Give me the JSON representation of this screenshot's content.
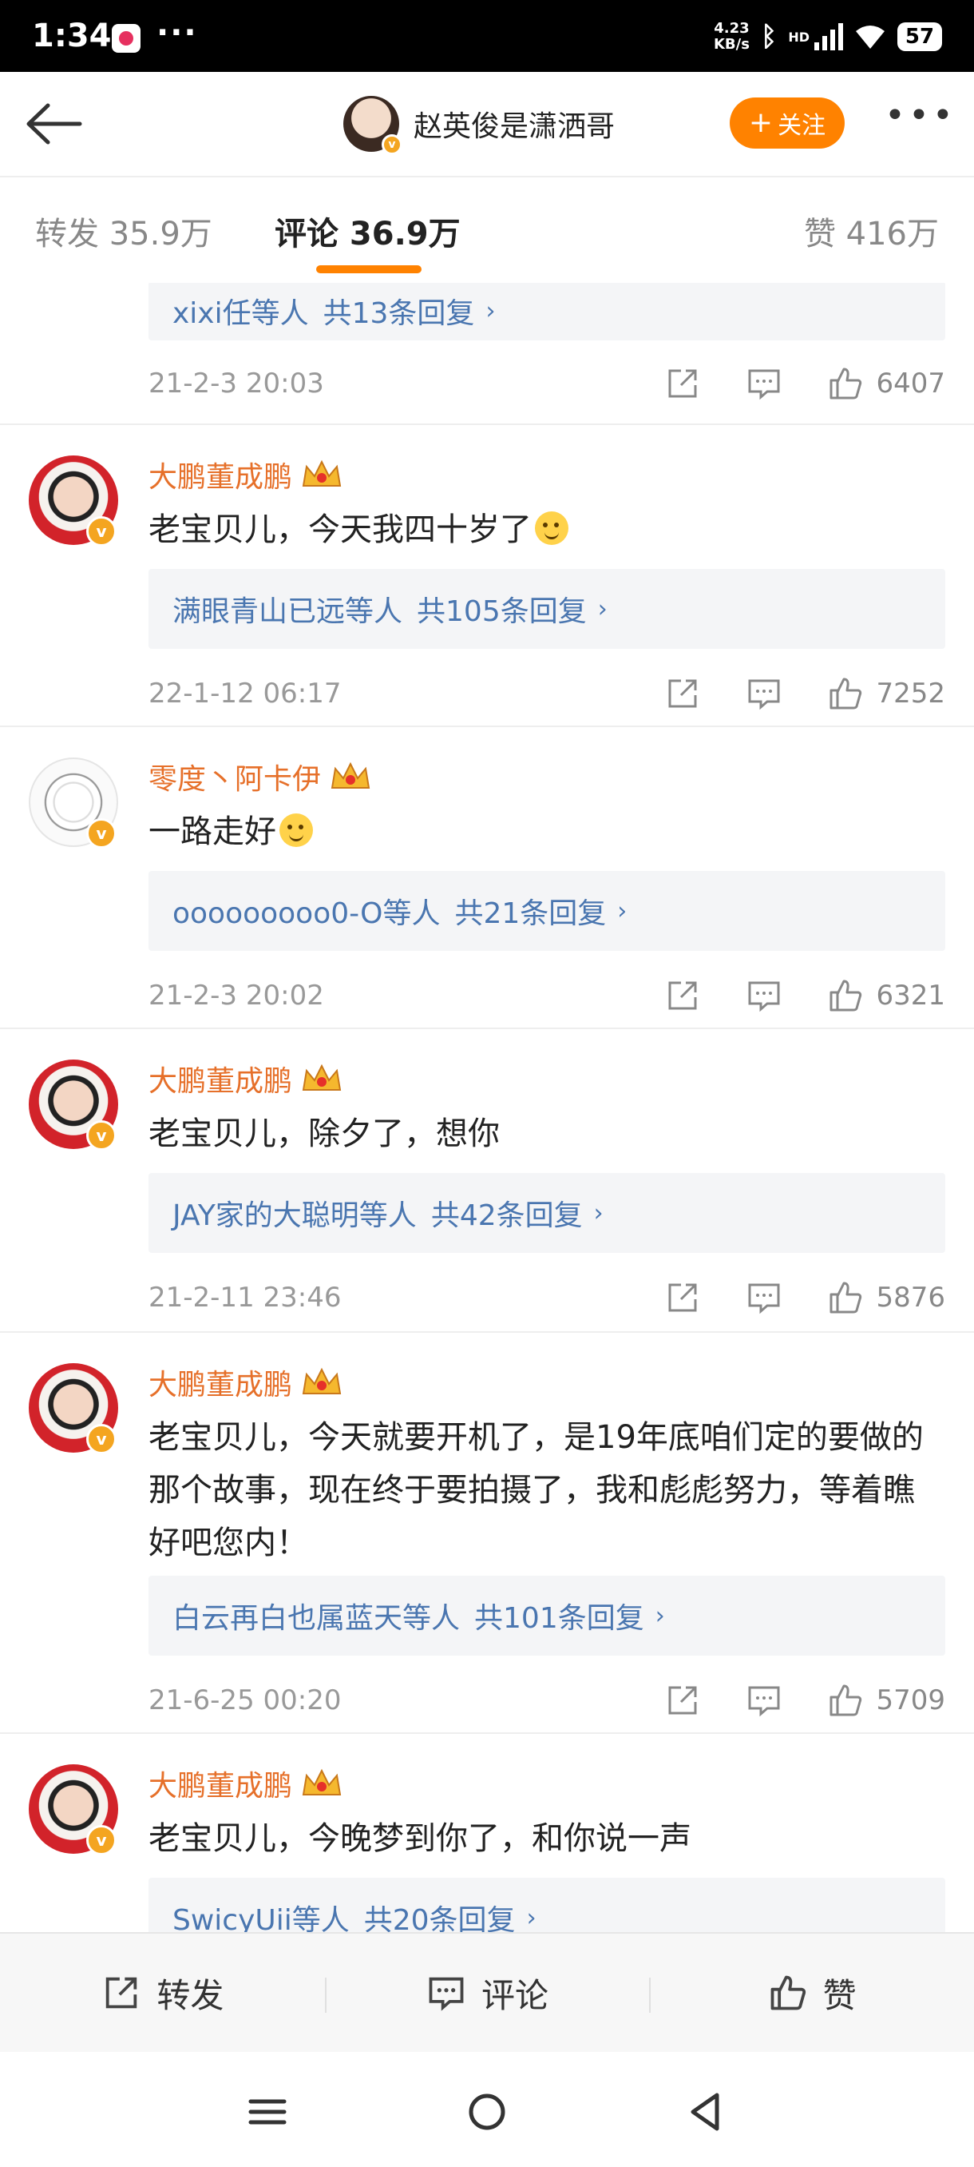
{
  "status_bar": {
    "time": "1:34",
    "net_speed_value": "4.23",
    "net_speed_unit": "KB/s",
    "hd": "HD",
    "battery": "57"
  },
  "header": {
    "profile_name": "赵英俊是潇洒哥",
    "follow_label": "关注"
  },
  "tabs": {
    "repost": "转发 35.9万",
    "comment": "评论 36.9万",
    "like": "赞 416万"
  },
  "comments": [
    {
      "replies_who": "xixi任等人",
      "replies_count": "共13条回复",
      "time": "21-2-3 20:03",
      "likes": "6407"
    },
    {
      "user": "大鹏董成鹏",
      "text": "老宝贝儿，今天我四十岁了",
      "replies_who": "满眼青山已远等人",
      "replies_count": "共105条回复",
      "time": "22-1-12 06:17",
      "likes": "7252"
    },
    {
      "user": "零度丶阿卡伊",
      "text": "一路走好",
      "replies_who": "ooooooooo0-O等人",
      "replies_count": "共21条回复",
      "time": "21-2-3 20:02",
      "likes": "6321"
    },
    {
      "user": "大鹏董成鹏",
      "text": "老宝贝儿，除夕了，想你",
      "replies_who": "JAY家的大聪明等人",
      "replies_count": "共42条回复",
      "time": "21-2-11 23:46",
      "likes": "5876"
    },
    {
      "user": "大鹏董成鹏",
      "text": "老宝贝儿，今天就要开机了，是19年底咱们定的要做的那个故事，现在终于要拍摄了，我和彪彪努力，等着瞧好吧您内！",
      "replies_who": "白云再白也属蓝天等人",
      "replies_count": "共101条回复",
      "time": "21-6-25 00:20",
      "likes": "5709"
    },
    {
      "user": "大鹏董成鹏",
      "text": "老宝贝儿，今晚梦到你了，和你说一声",
      "replies_who": "SwicyUii等人",
      "replies_count": "共20条回复"
    }
  ],
  "bottom_bar": {
    "repost": "转发",
    "comment": "评论",
    "like": "赞"
  },
  "colors": {
    "accent": "#ff8200",
    "username": "#e6702a",
    "link": "#4a76b0"
  }
}
